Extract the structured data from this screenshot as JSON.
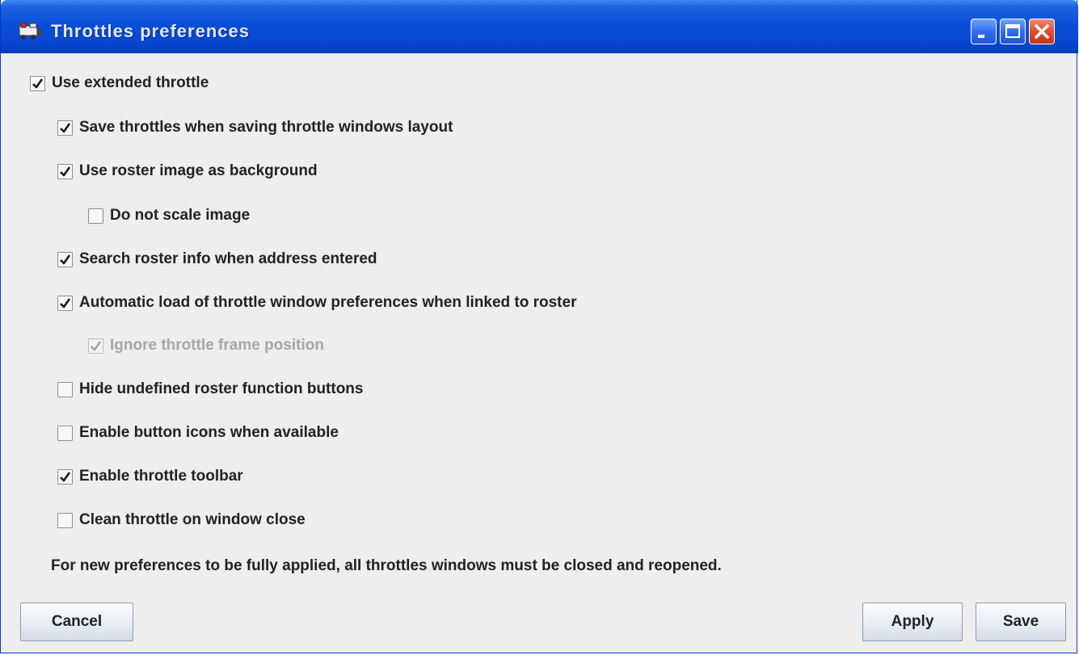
{
  "window": {
    "title": "Throttles preferences"
  },
  "options": [
    {
      "id": "use-extended-throttle",
      "label": "Use extended throttle",
      "checked": true,
      "enabled": true
    },
    {
      "id": "save-throttles",
      "label": "Save throttles when saving throttle windows layout",
      "checked": true,
      "enabled": true
    },
    {
      "id": "use-roster-image",
      "label": "Use roster image as background",
      "checked": true,
      "enabled": true
    },
    {
      "id": "do-not-scale-image",
      "label": "Do not scale image",
      "checked": false,
      "enabled": true
    },
    {
      "id": "search-roster-info",
      "label": "Search roster info when address entered",
      "checked": true,
      "enabled": true
    },
    {
      "id": "automatic-load-prefs",
      "label": "Automatic load of throttle window preferences when linked to roster",
      "checked": true,
      "enabled": true
    },
    {
      "id": "ignore-frame-position",
      "label": "Ignore throttle frame position",
      "checked": true,
      "enabled": false
    },
    {
      "id": "hide-undefined-buttons",
      "label": "Hide undefined roster function buttons",
      "checked": false,
      "enabled": true
    },
    {
      "id": "enable-button-icons",
      "label": "Enable button icons when available",
      "checked": false,
      "enabled": true
    },
    {
      "id": "enable-toolbar",
      "label": "Enable throttle toolbar",
      "checked": true,
      "enabled": true
    },
    {
      "id": "clean-throttle",
      "label": "Clean throttle on window close",
      "checked": false,
      "enabled": true
    }
  ],
  "note": "For new preferences to be fully applied, all throttles windows must be closed and reopened.",
  "buttons": {
    "cancel": "Cancel",
    "apply": "Apply",
    "save": "Save"
  },
  "colors": {
    "titlebar": "#0a4fd8",
    "background": "#eeeeee",
    "disabled_text": "#a7a7a7"
  }
}
